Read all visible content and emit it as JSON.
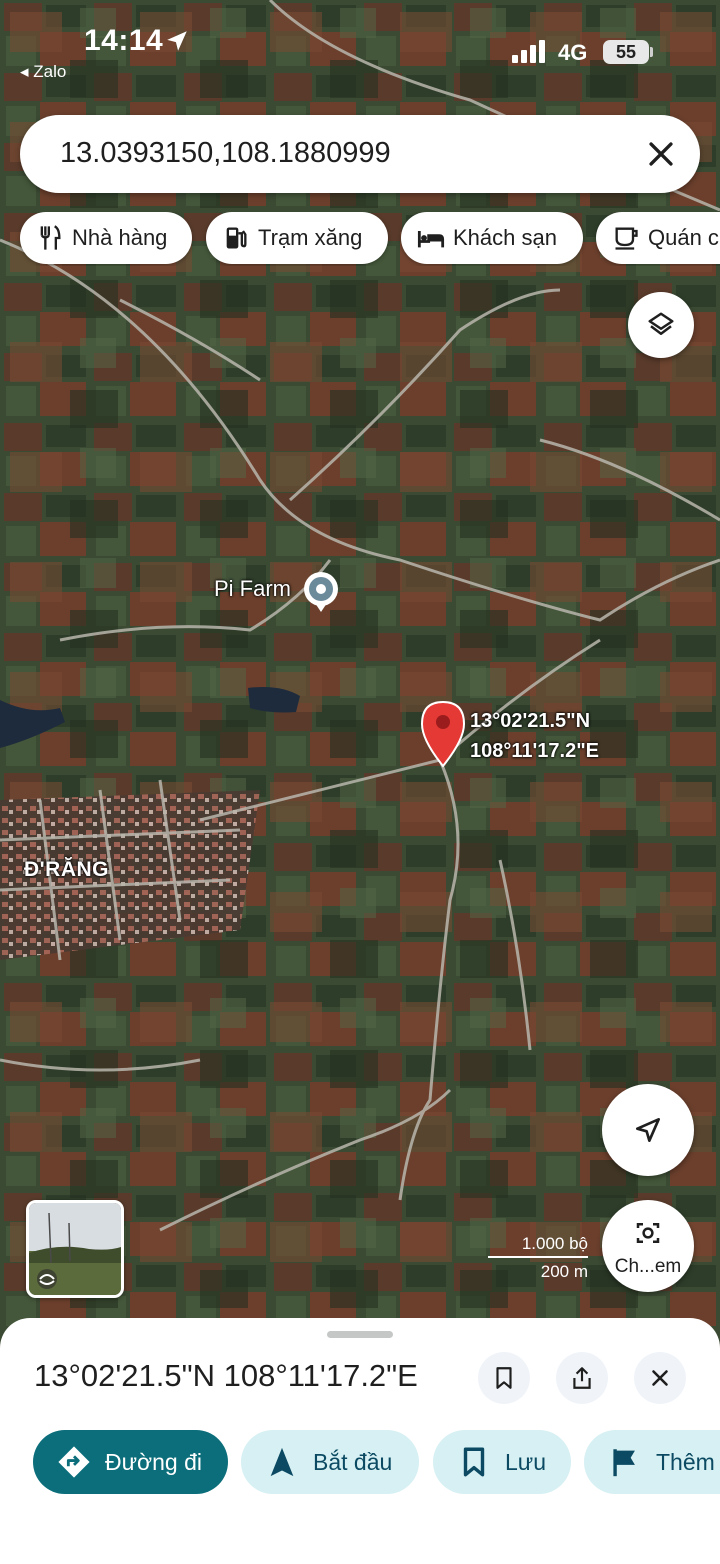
{
  "status_bar": {
    "time": "14:14",
    "back_app": "◂ Zalo",
    "network": "4G",
    "battery": "55"
  },
  "search": {
    "query": "13.0393150,108.1880999"
  },
  "categories": [
    {
      "label": "Nhà hàng",
      "icon": "restaurant-icon"
    },
    {
      "label": "Trạm xăng",
      "icon": "gas-station-icon"
    },
    {
      "label": "Khách sạn",
      "icon": "hotel-icon"
    },
    {
      "label": "Quán c",
      "icon": "coffee-icon"
    }
  ],
  "map": {
    "view": "satellite",
    "places": {
      "pi_farm": "Pi Farm",
      "town": "Đ'RĂNG"
    },
    "pin_label": {
      "lat": "13°02'21.5\"N",
      "lng": "108°11'17.2\"E"
    },
    "scale": {
      "imperial": "1.000 bộ",
      "metric": "200 m"
    },
    "lens_label": "Ch...em"
  },
  "place_sheet": {
    "title": "13°02'21.5\"N 108°11'17.2\"E",
    "actions": {
      "directions": "Đường đi",
      "start": "Bắt đầu",
      "save": "Lưu",
      "more": "Thêm"
    }
  },
  "colors": {
    "primary": "#0b6e7a",
    "secondary_bg": "#d6f0f3",
    "pin": "#e53935"
  }
}
